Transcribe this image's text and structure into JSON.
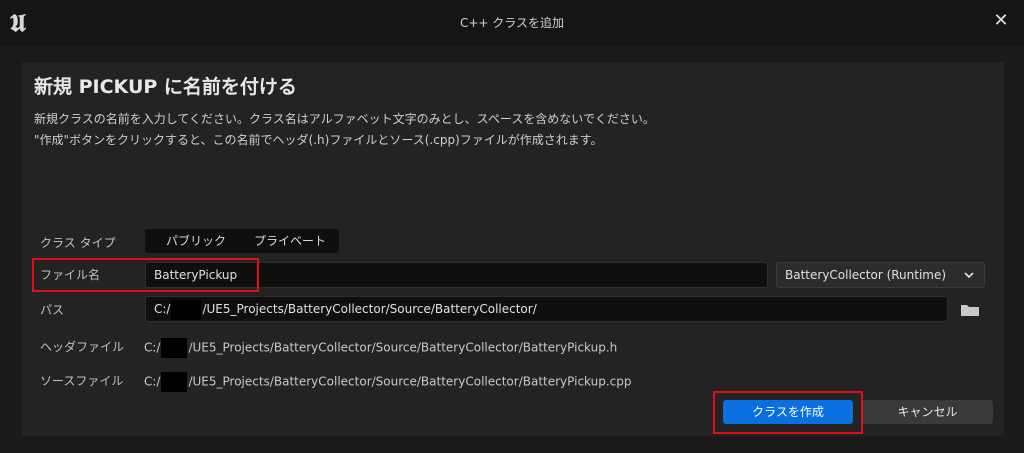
{
  "window": {
    "title": "C++ クラスを追加",
    "logo_icon": "unreal-logo-icon",
    "close_icon": "close-icon"
  },
  "main": {
    "heading": "新規 PICKUP に名前を付ける",
    "description_line1": "新規クラスの名前を入力してください。クラス名はアルファベット文字のみとし、スペースを含めないでください。",
    "description_line2": "\"作成\"ボタンをクリックすると、この名前でヘッダ(.h)ファイルとソース(.cpp)ファイルが作成されます。"
  },
  "form": {
    "class_type_label": "クラス タイプ",
    "class_type_options": [
      "パブリック",
      "プライベート"
    ],
    "file_name_label": "ファイル名",
    "file_name_value": "BatteryPickup",
    "module_value": "BatteryCollector (Runtime)",
    "path_label": "パス",
    "path_prefix": "C:/",
    "path_suffix": "/UE5_Projects/BatteryCollector/Source/BatteryCollector/",
    "header_label": "ヘッダファイル",
    "header_prefix": "C:/",
    "header_suffix": "/UE5_Projects/BatteryCollector/Source/BatteryCollector/BatteryPickup.h",
    "source_label": "ソースファイル",
    "source_prefix": "C:/",
    "source_suffix": "/UE5_Projects/BatteryCollector/Source/BatteryCollector/BatteryPickup.cpp"
  },
  "buttons": {
    "create_label": "クラスを作成",
    "cancel_label": "キャンセル"
  },
  "colors": {
    "accent": "#0a70e0",
    "highlight": "#e0101a"
  }
}
